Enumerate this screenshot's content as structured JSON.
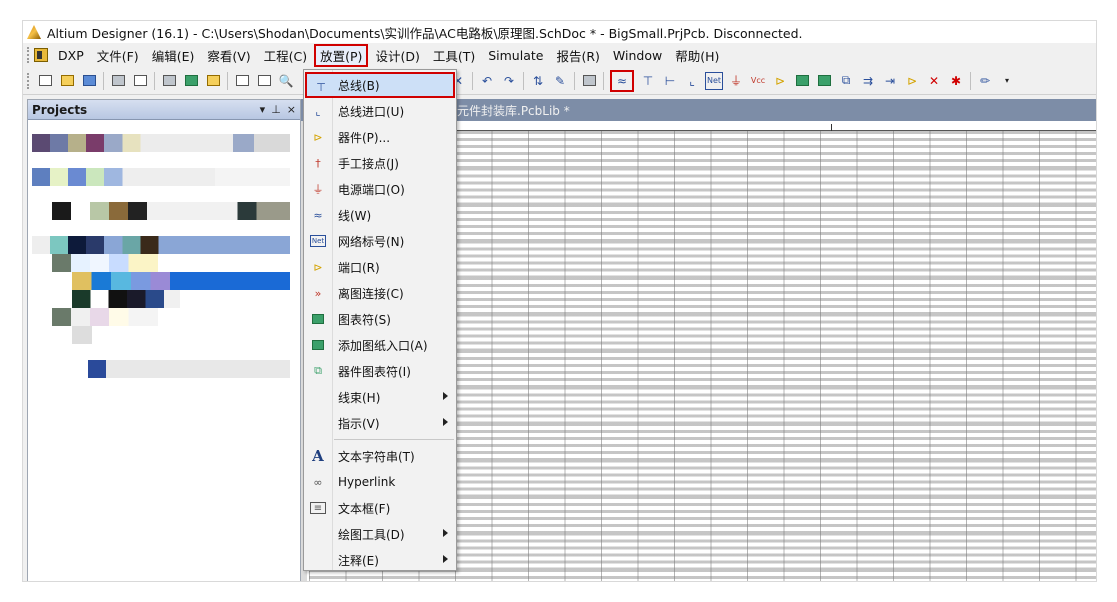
{
  "window": {
    "title": "Altium Designer (16.1) - C:\\Users\\Shodan\\Documents\\实训作品\\AC电路板\\原理图.SchDoc * - BigSmall.PrjPcb. Disconnected."
  },
  "menubar": {
    "items": [
      "DXP",
      "文件(F)",
      "编辑(E)",
      "察看(V)",
      "工程(C)",
      "放置(P)",
      "设计(D)",
      "工具(T)",
      "Simulate",
      "报告(R)",
      "Window",
      "帮助(H)"
    ],
    "highlighted": "放置(P)"
  },
  "projects_panel": {
    "title": "Projects",
    "header_buttons": [
      "▾",
      "⊥",
      "×"
    ]
  },
  "document": {
    "tab_label": "元件封装库.PcbLib *"
  },
  "place_menu": {
    "items": [
      {
        "label": "总线(B)",
        "icon": "bus-icon",
        "selected": true
      },
      {
        "label": "总线进口(U)",
        "icon": "bus-entry-icon"
      },
      {
        "label": "器件(P)...",
        "icon": "part-icon"
      },
      {
        "label": "手工接点(J)",
        "icon": "junction-icon"
      },
      {
        "label": "电源端口(O)",
        "icon": "power-port-icon"
      },
      {
        "label": "线(W)",
        "icon": "wire-icon"
      },
      {
        "label": "网络标号(N)",
        "icon": "net-label-icon",
        "icon_text": "Net"
      },
      {
        "label": "端口(R)",
        "icon": "port-icon"
      },
      {
        "label": "离图连接(C)",
        "icon": "off-sheet-connector-icon"
      },
      {
        "label": "图表符(S)",
        "icon": "sheet-symbol-icon"
      },
      {
        "label": "添加图纸入口(A)",
        "icon": "sheet-entry-icon"
      },
      {
        "label": "器件图表符(I)",
        "icon": "device-sheet-symbol-icon"
      },
      {
        "label": "线束(H)",
        "submenu": true
      },
      {
        "label": "指示(V)",
        "submenu": true
      },
      {
        "label": "文本字符串(T)",
        "icon": "text-icon",
        "group_start": true
      },
      {
        "label": "Hyperlink",
        "icon": "hyperlink-icon"
      },
      {
        "label": "文本框(F)",
        "icon": "text-frame-icon"
      },
      {
        "label": "绘图工具(D)",
        "submenu": true
      },
      {
        "label": "注释(E)",
        "submenu": true
      }
    ]
  },
  "toolbar": {
    "highlighted": "wire-tool-icon",
    "net_label_text": "Net",
    "vcc_text": "Vcc"
  },
  "colors": {
    "highlight_border": "#d00000",
    "menu_selected_bg": "#cde0f7",
    "panel_header": "#b8c7e2",
    "doc_tab": "#7d8da7"
  }
}
